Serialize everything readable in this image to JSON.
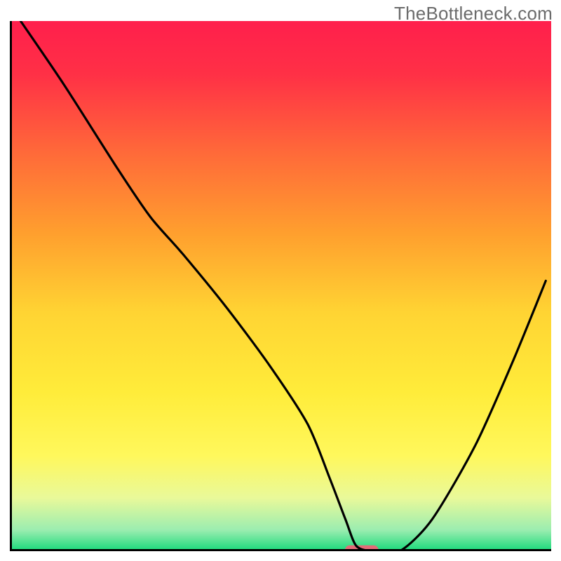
{
  "watermark": "TheBottleneck.com",
  "chart_data": {
    "type": "line",
    "title": "",
    "xlabel": "",
    "ylabel": "",
    "xlim": [
      0,
      100
    ],
    "ylim": [
      0,
      100
    ],
    "grid": false,
    "legend": false,
    "background_gradient": {
      "stops": [
        {
          "offset": 0.0,
          "color": "#ff1f4c"
        },
        {
          "offset": 0.1,
          "color": "#ff3046"
        },
        {
          "offset": 0.25,
          "color": "#ff6a39"
        },
        {
          "offset": 0.4,
          "color": "#ff9f2e"
        },
        {
          "offset": 0.55,
          "color": "#ffd433"
        },
        {
          "offset": 0.7,
          "color": "#ffec3a"
        },
        {
          "offset": 0.82,
          "color": "#fff85c"
        },
        {
          "offset": 0.9,
          "color": "#e9f99a"
        },
        {
          "offset": 0.96,
          "color": "#9bedb0"
        },
        {
          "offset": 1.0,
          "color": "#17d97a"
        }
      ]
    },
    "series": [
      {
        "name": "curve",
        "color": "#000000",
        "x": [
          2,
          10,
          20,
          26,
          32,
          40,
          48,
          55,
          59,
          62,
          64,
          67,
          72,
          78,
          86,
          93,
          99
        ],
        "y": [
          100,
          88,
          72,
          63,
          56,
          46,
          35,
          24,
          14,
          6,
          1,
          0,
          0,
          6,
          20,
          36,
          51
        ]
      }
    ],
    "marker": {
      "shape": "rounded-rect",
      "x": 65,
      "y": 0.2,
      "width": 6.2,
      "height": 1.8,
      "color": "#e36b78"
    },
    "axes": {
      "left": {
        "color": "#000000",
        "width": 3
      },
      "bottom": {
        "color": "#000000",
        "width": 3
      }
    }
  }
}
